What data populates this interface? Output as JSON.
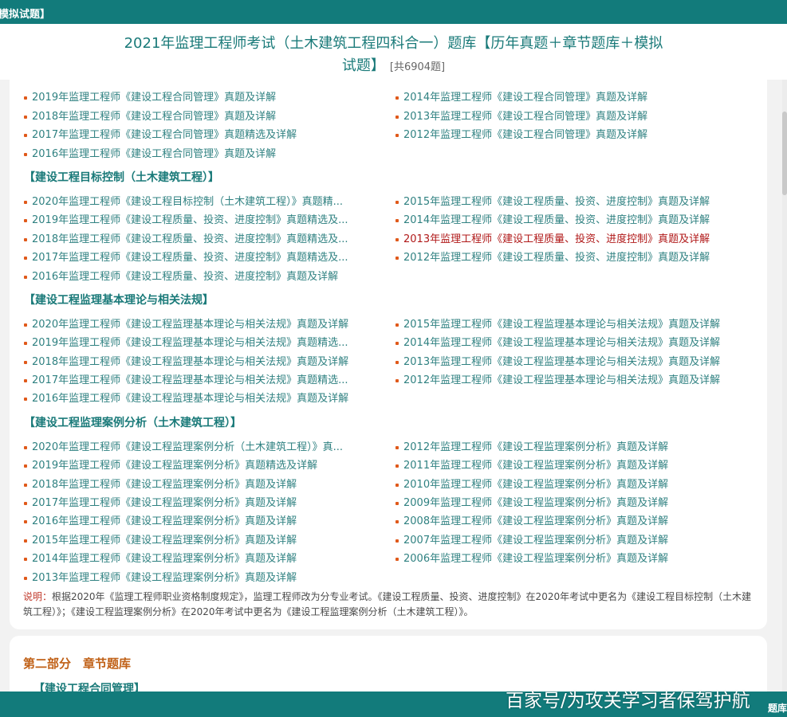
{
  "top_bar": {
    "crumb": "模拟试题】"
  },
  "header": {
    "title_line1": "2021年监理工程师考试（土木建筑工程四科合一）题库【历年真题＋章节题库＋模拟",
    "title_line2": "试题】",
    "count": "[共6904题]"
  },
  "groups": [
    {
      "title": "",
      "left": [
        "2019年监理工程师《建设工程合同管理》真题及详解",
        "2018年监理工程师《建设工程合同管理》真题及详解",
        "2017年监理工程师《建设工程合同管理》真题精选及详解",
        "2016年监理工程师《建设工程合同管理》真题及详解"
      ],
      "right": [
        "2014年监理工程师《建设工程合同管理》真题及详解",
        "2013年监理工程师《建设工程合同管理》真题及详解",
        "2012年监理工程师《建设工程合同管理》真题及详解"
      ]
    },
    {
      "title": "【建设工程目标控制（土木建筑工程）】",
      "left": [
        "2020年监理工程师《建设工程目标控制（土木建筑工程）》真题精...",
        "2019年监理工程师《建设工程质量、投资、进度控制》真题精选及...",
        "2018年监理工程师《建设工程质量、投资、进度控制》真题精选及...",
        "2017年监理工程师《建设工程质量、投资、进度控制》真题精选及...",
        "2016年监理工程师《建设工程质量、投资、进度控制》真题及详解"
      ],
      "right": [
        "2015年监理工程师《建设工程质量、投资、进度控制》真题及详解",
        "2014年监理工程师《建设工程质量、投资、进度控制》真题及详解",
        "2013年监理工程师《建设工程质量、投资、进度控制》真题及详解",
        "2012年监理工程师《建设工程质量、投资、进度控制》真题及详解"
      ]
    },
    {
      "title": "【建设工程监理基本理论与相关法规】",
      "left": [
        "2020年监理工程师《建设工程监理基本理论与相关法规》真题及详解",
        "2019年监理工程师《建设工程监理基本理论与相关法规》真题精选...",
        "2018年监理工程师《建设工程监理基本理论与相关法规》真题及详解",
        "2017年监理工程师《建设工程监理基本理论与相关法规》真题精选...",
        "2016年监理工程师《建设工程监理基本理论与相关法规》真题及详解"
      ],
      "right": [
        "2015年监理工程师《建设工程监理基本理论与相关法规》真题及详解",
        "2014年监理工程师《建设工程监理基本理论与相关法规》真题及详解",
        "2013年监理工程师《建设工程监理基本理论与相关法规》真题及详解",
        "2012年监理工程师《建设工程监理基本理论与相关法规》真题及详解"
      ]
    },
    {
      "title": "【建设工程监理案例分析（土木建筑工程）】",
      "left": [
        "2020年监理工程师《建设工程监理案例分析（土木建筑工程）》真...",
        "2019年监理工程师《建设工程监理案例分析》真题精选及详解",
        "2018年监理工程师《建设工程监理案例分析》真题及详解",
        "2017年监理工程师《建设工程监理案例分析》真题及详解",
        "2016年监理工程师《建设工程监理案例分析》真题及详解",
        "2015年监理工程师《建设工程监理案例分析》真题及详解",
        "2014年监理工程师《建设工程监理案例分析》真题及详解",
        "2013年监理工程师《建设工程监理案例分析》真题及详解"
      ],
      "right": [
        "2012年监理工程师《建设工程监理案例分析》真题及详解",
        "2011年监理工程师《建设工程监理案例分析》真题及详解",
        "2010年监理工程师《建设工程监理案例分析》真题及详解",
        "2009年监理工程师《建设工程监理案例分析》真题及详解",
        "2008年监理工程师《建设工程监理案例分析》真题及详解",
        "2007年监理工程师《建设工程监理案例分析》真题及详解",
        "2006年监理工程师《建设工程监理案例分析》真题及详解"
      ]
    }
  ],
  "note": {
    "label": "说明：",
    "text": "根据2020年《监理工程师职业资格制度规定》，监理工程师改为分专业考试。《建设工程质量、投资、进度控制》在2020年考试中更名为《建设工程目标控制（土木建筑工程）》；《建设工程监理案例分析》在2020年考试中更名为《建设工程监理案例分析（土木建筑工程）》。"
  },
  "part2": {
    "title": "第二部分　章节题库",
    "next_section": "【建设工程合同管理】"
  },
  "bottom_bar": {
    "tag": "题库"
  },
  "watermark": "百家号/为攻关学习者保驾护航",
  "colors": {
    "brand": "#127b7b",
    "link": "#2f8181",
    "visited": "#b01818",
    "bullet": "#e0591a",
    "part_title": "#c06016"
  }
}
